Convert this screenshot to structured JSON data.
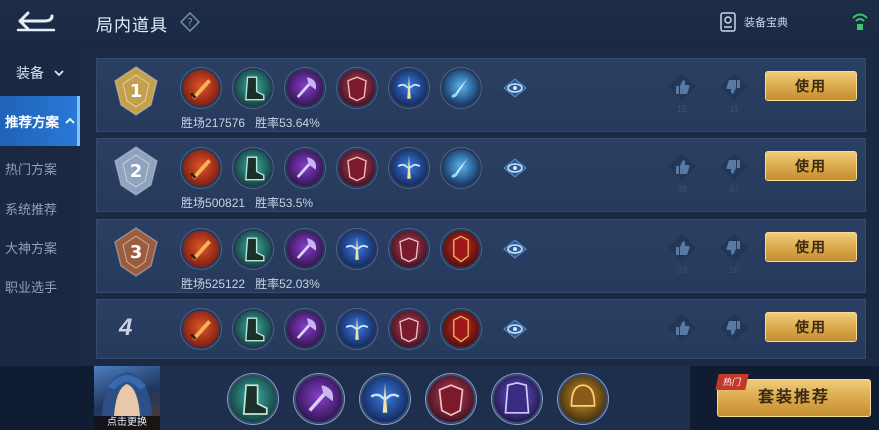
{
  "header": {
    "title": "局内道具",
    "codex_label": "装备宝典"
  },
  "sidebar": {
    "group_label": "装备",
    "active_label": "推荐方案",
    "items": [
      {
        "label": "热门方案"
      },
      {
        "label": "系统推荐"
      },
      {
        "label": "大神方案"
      },
      {
        "label": "职业选手"
      }
    ]
  },
  "plans": [
    {
      "rank": "1",
      "wins_label": "胜场",
      "wins": "217576",
      "rate_label": "胜率",
      "rate": "53.64%",
      "likes": "15",
      "dislikes": "11",
      "use_label": "使用",
      "items": [
        "sword-icon",
        "boots-icon",
        "axe-icon",
        "armor-icon",
        "winged-blade-icon",
        "ice-blade-icon"
      ]
    },
    {
      "rank": "2",
      "wins_label": "胜场",
      "wins": "500821",
      "rate_label": "胜率",
      "rate": "53.5%",
      "likes": "38",
      "dislikes": "47",
      "use_label": "使用",
      "items": [
        "sword-icon",
        "boots-icon",
        "axe-icon",
        "armor-icon",
        "winged-blade-icon",
        "ice-blade-icon"
      ]
    },
    {
      "rank": "3",
      "wins_label": "胜场",
      "wins": "525122",
      "rate_label": "胜率",
      "rate": "52.03%",
      "likes": "33",
      "dislikes": "16",
      "use_label": "使用",
      "items": [
        "sword-icon",
        "boots-icon",
        "axe-icon",
        "winged-blade-icon",
        "armor-icon",
        "red-armor-icon"
      ]
    },
    {
      "rank": "4",
      "likes": "",
      "dislikes": "",
      "use_label": "使用",
      "items": [
        "sword-icon",
        "boots-icon",
        "axe-icon",
        "winged-blade-icon",
        "armor-icon",
        "red-armor-icon"
      ]
    }
  ],
  "bottom": {
    "hero_label": "点击更换",
    "build_items": [
      "boots-icon",
      "axe-icon",
      "winged-blade-icon",
      "armor-icon",
      "purple-armor-icon",
      "gold-helm-icon"
    ],
    "hot_label": "热门",
    "suit_label": "套装推荐"
  },
  "colors": {
    "accent": "#2a7ad8",
    "gold_button": "#d9a74a",
    "rank1": "#e0b24a",
    "rank2": "#9fb5cf",
    "rank3": "#b0633a"
  }
}
